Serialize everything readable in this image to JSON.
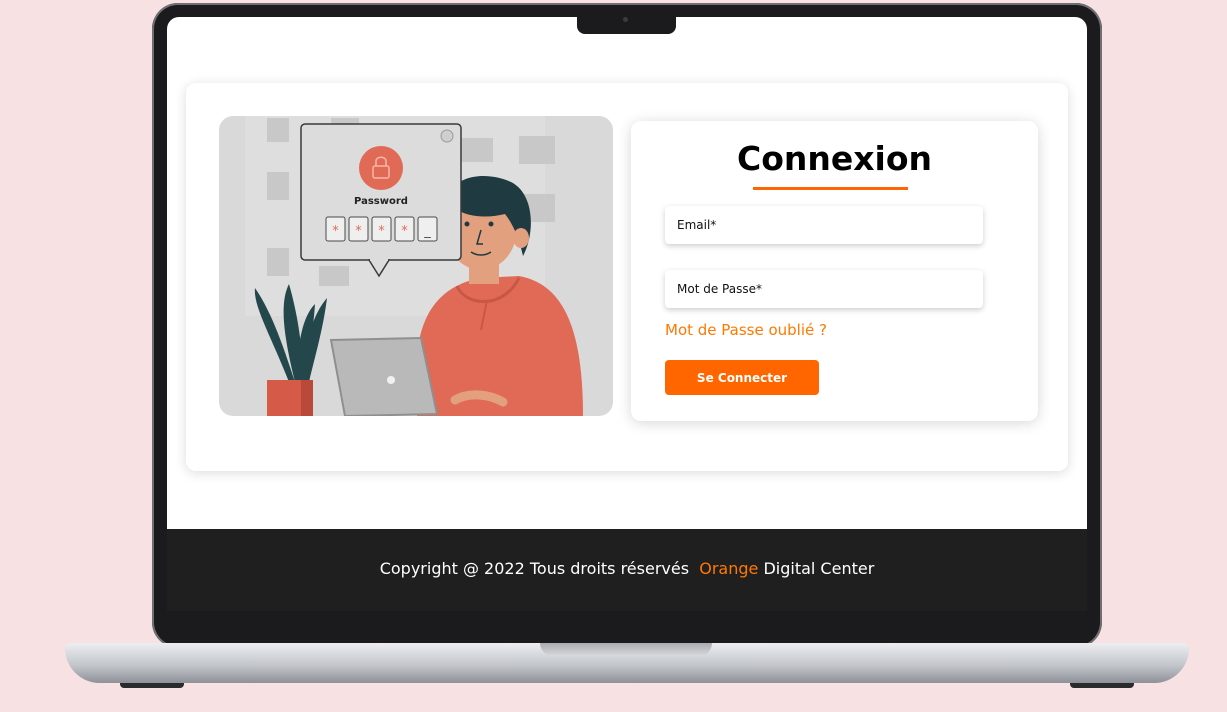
{
  "illustration": {
    "popup_label": "Password",
    "password_chars": [
      "*",
      "*",
      "*",
      "*",
      "_"
    ]
  },
  "login": {
    "title": "Connexion",
    "email_placeholder": "Email*",
    "password_placeholder": "Mot de Passe*",
    "forgot_link": "Mot de Passe oublié ?",
    "submit_label": "Se Connecter"
  },
  "footer": {
    "copyright_prefix": "Copyright @ 2022 Tous droits réservés",
    "brand_orange": "Orange",
    "brand_rest": "Digital Center"
  },
  "colors": {
    "accent": "#ff6600",
    "background": "#f8e1e2",
    "footer_bg": "#1f1f1f"
  }
}
